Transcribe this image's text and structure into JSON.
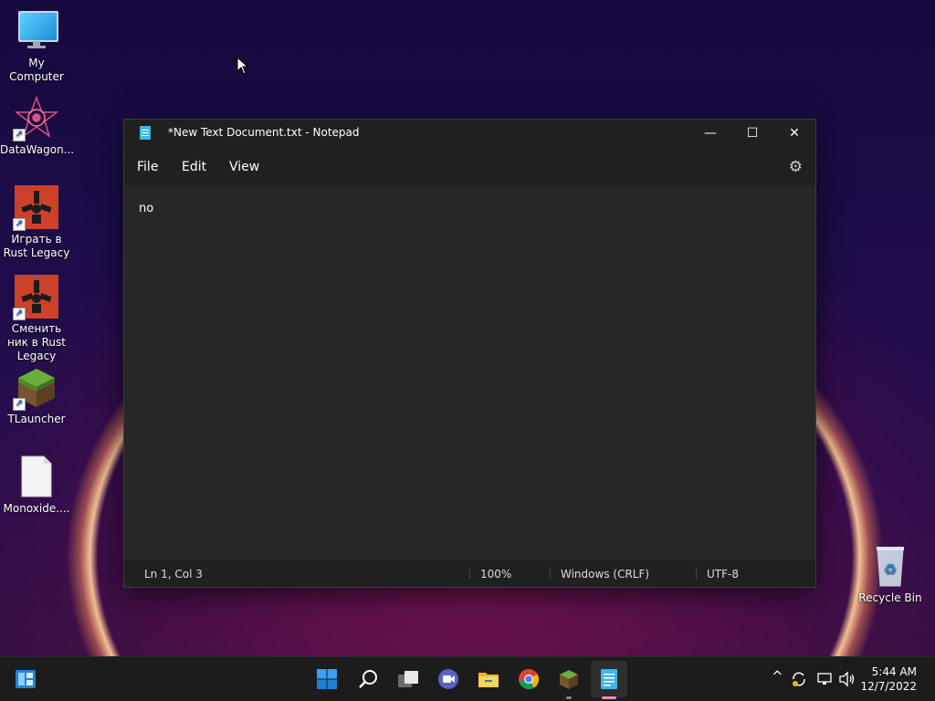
{
  "desktop": {
    "icons": [
      {
        "label": "My Computer"
      },
      {
        "label": "DataWagon..."
      },
      {
        "label": "Играть в Rust Legacy"
      },
      {
        "label": "Сменить ник в Rust Legacy"
      },
      {
        "label": "TLauncher"
      },
      {
        "label": "Monoxide...."
      },
      {
        "label": "Recycle Bin"
      }
    ]
  },
  "notepad": {
    "title": "*New Text Document.txt - Notepad",
    "controls": {
      "minimize": "—",
      "maximize": "☐",
      "close": "✕"
    },
    "menu": [
      "File",
      "Edit",
      "View"
    ],
    "settings_icon": "gear-icon",
    "content": "no",
    "status": {
      "position": "Ln 1, Col 3",
      "zoom": "100%",
      "line_ending": "Windows (CRLF)",
      "encoding": "UTF-8"
    }
  },
  "taskbar": {
    "icons": [
      "widgets-icon",
      "start-icon",
      "search-icon",
      "task-view-icon",
      "chat-icon",
      "file-explorer-icon",
      "chrome-icon",
      "tlauncher-icon",
      "notepad-icon"
    ],
    "tray": {
      "chevron": "^"
    },
    "clock": {
      "time": "5:44 AM",
      "date": "12/7/2022"
    }
  },
  "colors": {
    "accent": "#3fb6e8",
    "taskbar": "#1c1c1c",
    "window": "#272727"
  }
}
